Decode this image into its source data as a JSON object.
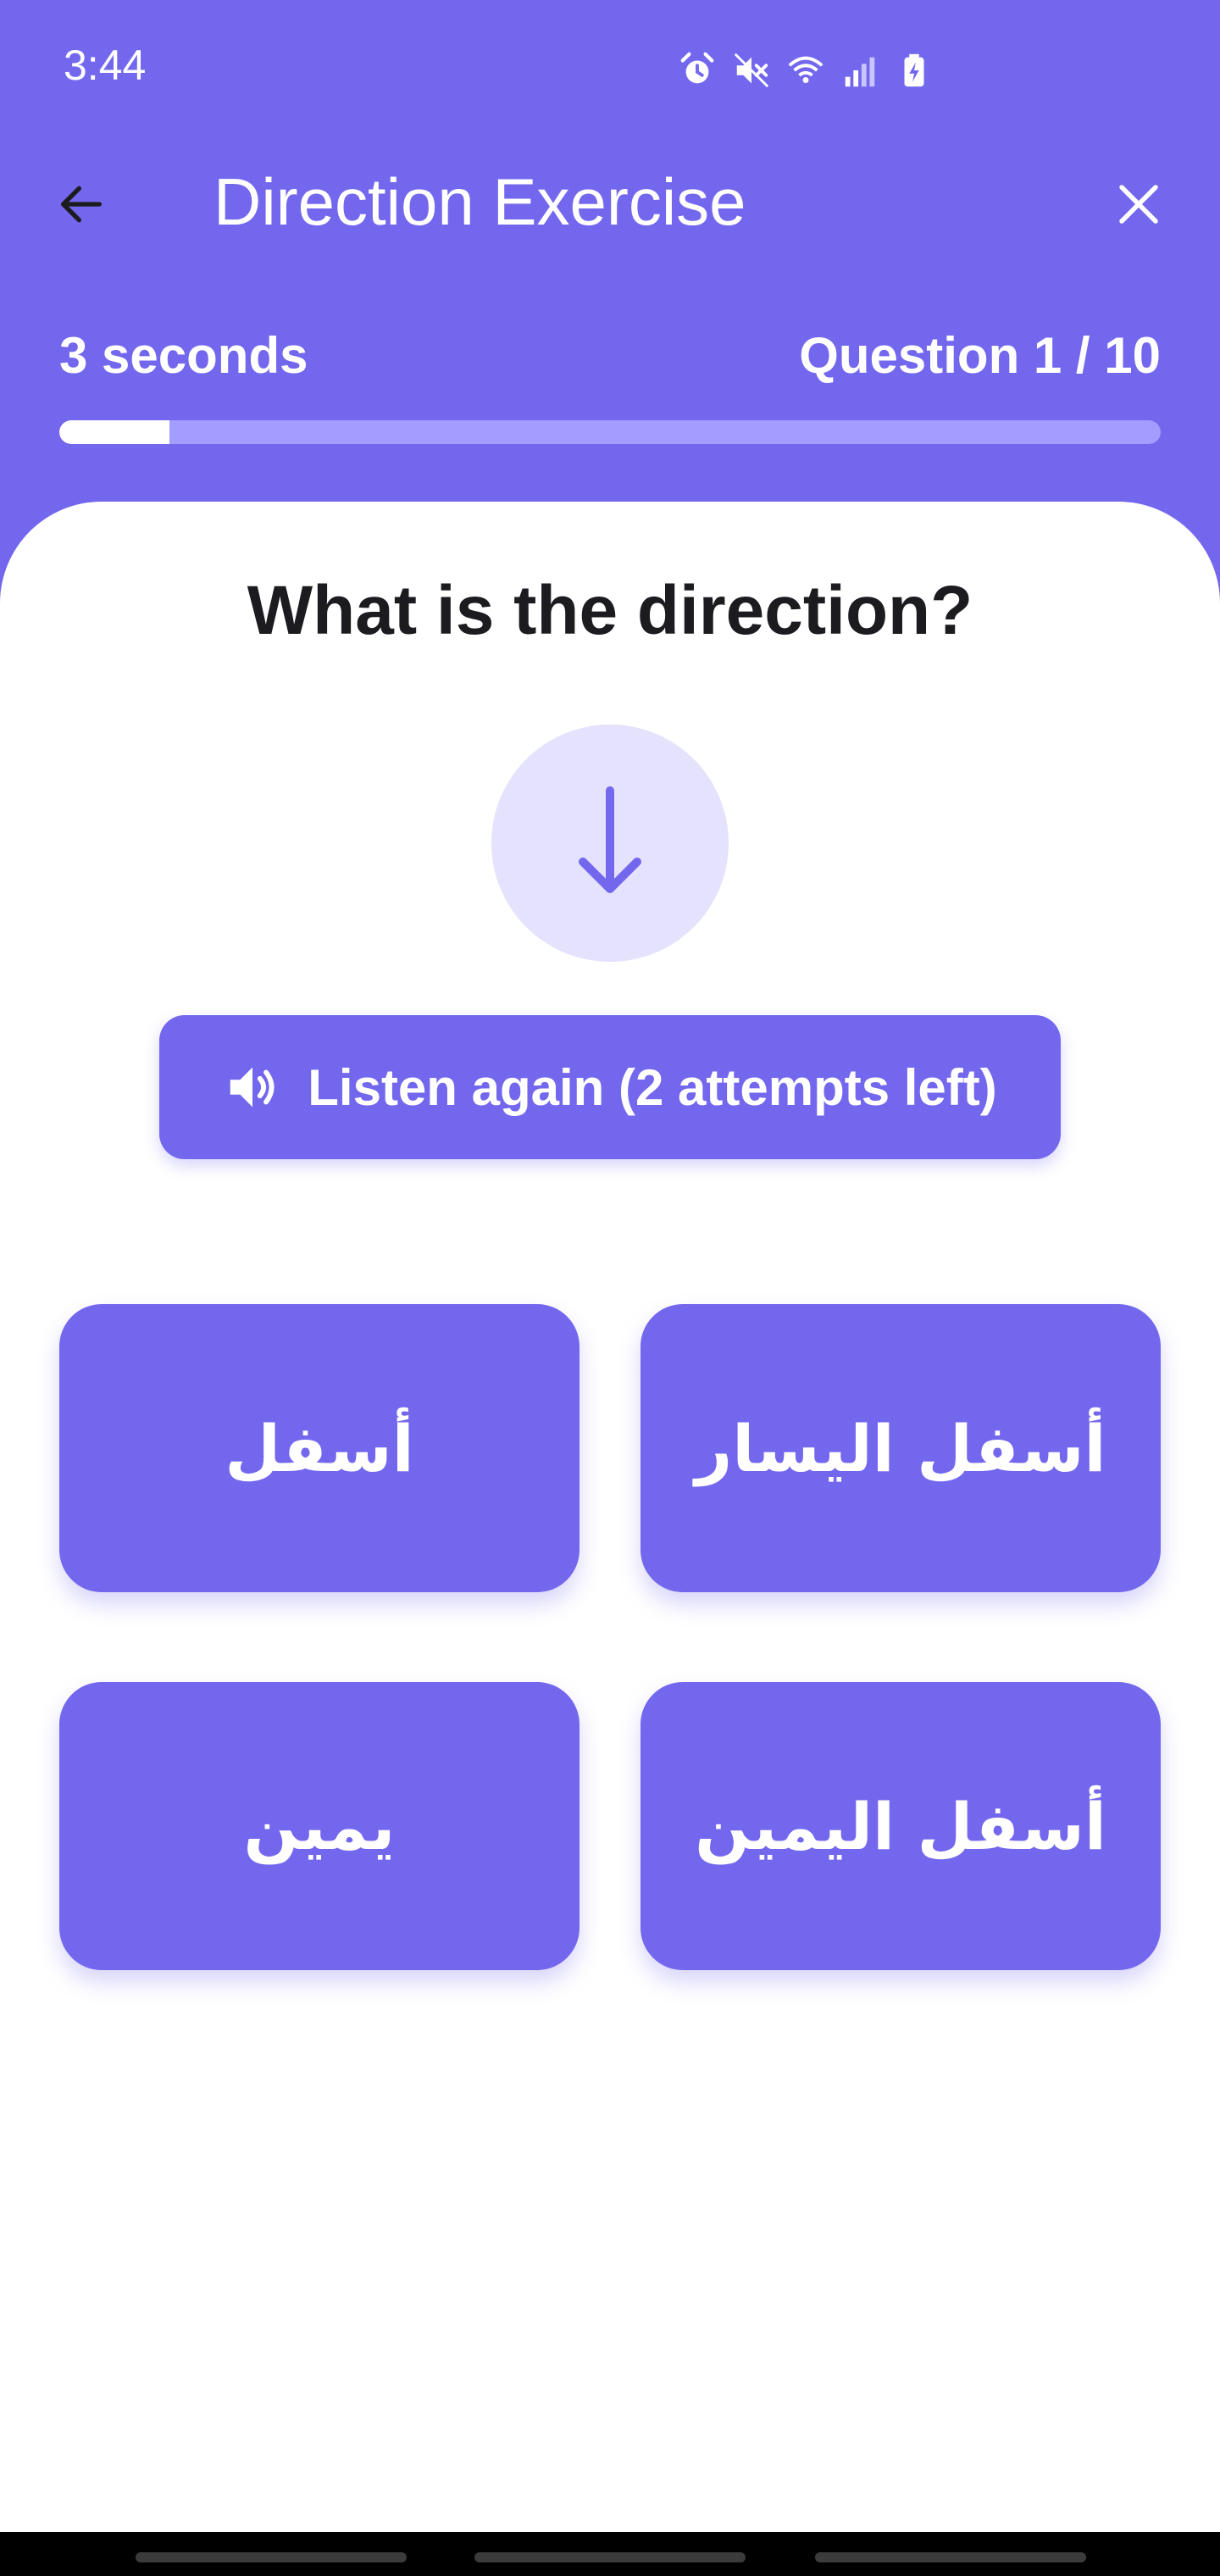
{
  "status_bar": {
    "time": "3:44",
    "icons": [
      "alarm-icon",
      "mute-icon",
      "wifi-icon",
      "signal-icon",
      "battery-charging-icon"
    ]
  },
  "app_bar": {
    "title": "Direction Exercise",
    "back_icon": "back-arrow-icon",
    "close_icon": "close-icon"
  },
  "progress": {
    "timer_label": "3 seconds",
    "question_label": "Question 1 / 10",
    "fraction": 0.1
  },
  "exercise": {
    "question": "What is the direction?",
    "direction_icon": "arrow-down-icon",
    "listen_label": "Listen again (2 attempts left)",
    "listen_icon": "volume-icon",
    "options": [
      "أسفل",
      "أسفل اليسار",
      "يمين",
      "أسفل اليمين"
    ]
  },
  "colors": {
    "primary": "#7367ee",
    "primary_light": "#e4e2fd",
    "progress_track": "#a39dff",
    "text_dark": "#1c1b1f",
    "white": "#ffffff"
  }
}
